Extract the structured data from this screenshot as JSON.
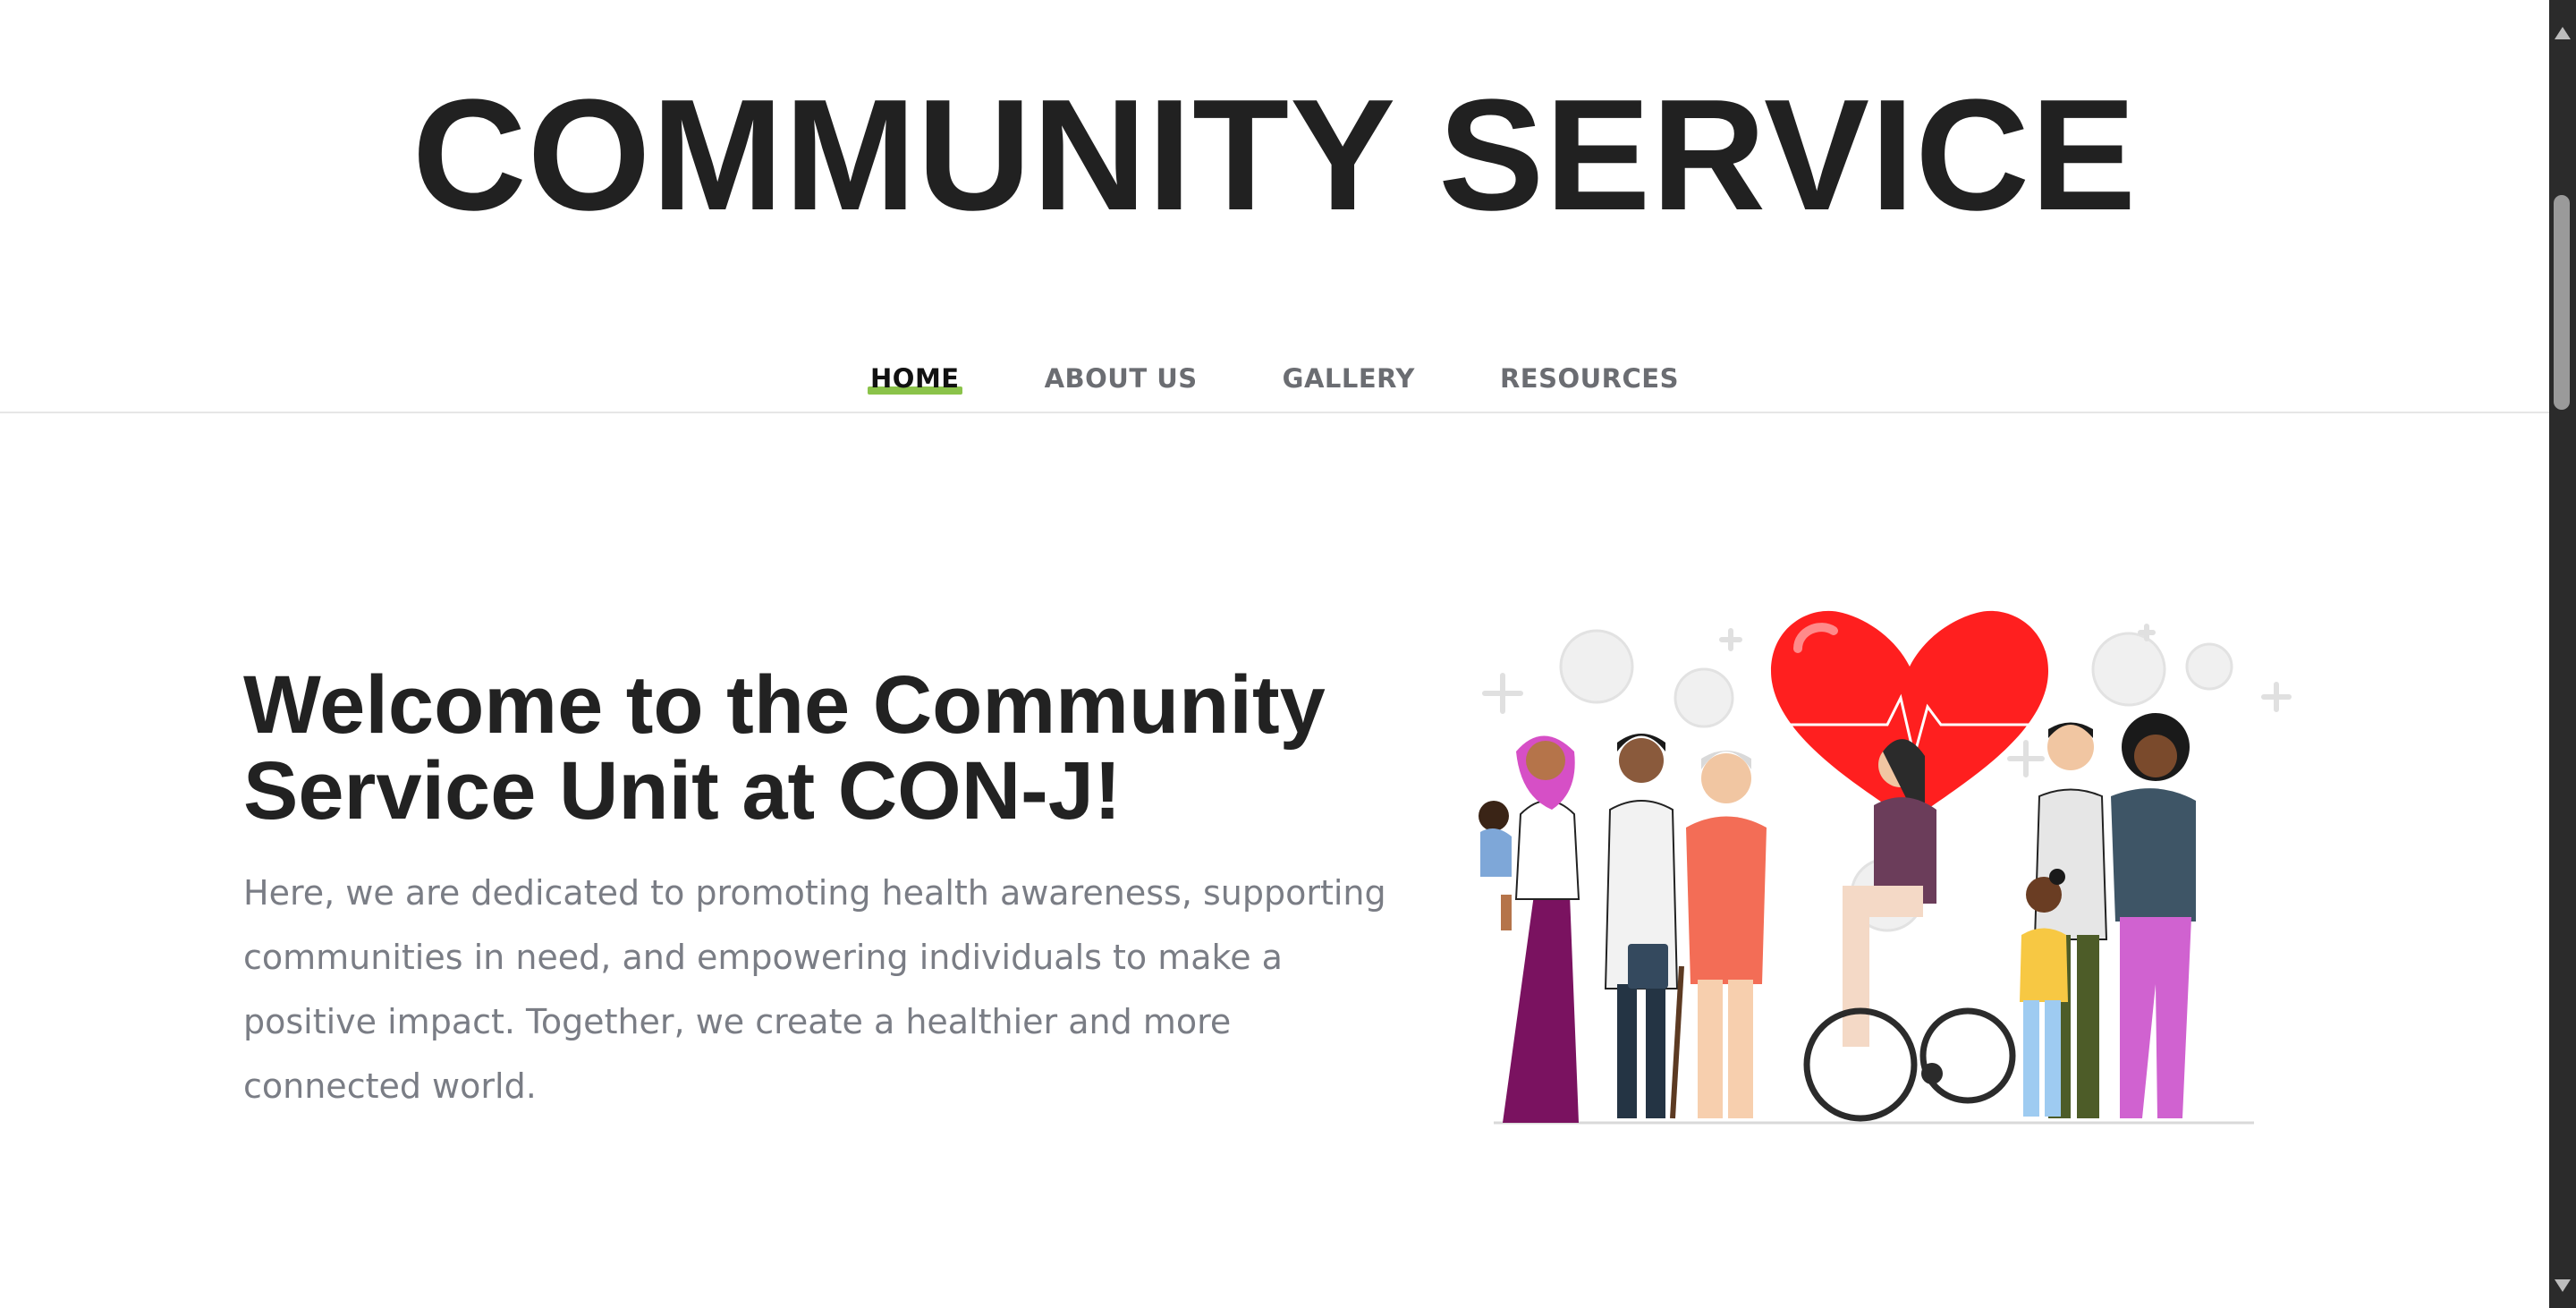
{
  "site": {
    "title": "COMMUNITY SERVICE"
  },
  "nav": {
    "items": [
      {
        "label": "HOME",
        "active": true
      },
      {
        "label": "ABOUT US",
        "active": false
      },
      {
        "label": "GALLERY",
        "active": false
      },
      {
        "label": "RESOURCES",
        "active": false
      }
    ],
    "accent_color": "#8bc34a"
  },
  "hero": {
    "heading": "Welcome to the Community Service Unit at CON-J!",
    "text": "Here, we are dedicated to promoting health awareness, supporting communities in need, and empowering individuals to make a positive impact. Together, we create a healthier and more connected world.",
    "illustration": "community-health-illustration",
    "heart_color": "#ff1f1f"
  },
  "scrollbar": {
    "position_fraction": 0.15
  }
}
